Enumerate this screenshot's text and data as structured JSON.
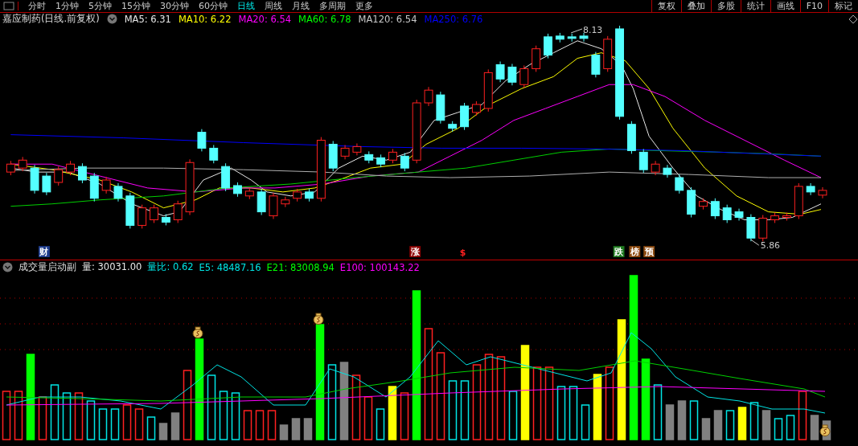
{
  "top_tabs": [
    {
      "label": "分时",
      "selected": false
    },
    {
      "label": "1分钟",
      "selected": false
    },
    {
      "label": "5分钟",
      "selected": false
    },
    {
      "label": "15分钟",
      "selected": false
    },
    {
      "label": "30分钟",
      "selected": false
    },
    {
      "label": "60分钟",
      "selected": false
    },
    {
      "label": "日线",
      "selected": true
    },
    {
      "label": "周线",
      "selected": false
    },
    {
      "label": "月线",
      "selected": false
    },
    {
      "label": "多周期",
      "selected": false
    },
    {
      "label": "更多",
      "selected": false
    }
  ],
  "toolbar_buttons": [
    "复权",
    "叠加",
    "多股",
    "统计",
    "画线",
    "F10",
    "标记"
  ],
  "price_panel": {
    "title": "嘉应制药(日线.前复权)",
    "indicators": [
      {
        "label": "MA5: 6.31",
        "color": "#e8e8e8"
      },
      {
        "label": "MA10: 6.22",
        "color": "#ffff00"
      },
      {
        "label": "MA20: 6.54",
        "color": "#ff00ff"
      },
      {
        "label": "MA60: 6.78",
        "color": "#00ff00"
      },
      {
        "label": "MA120: 6.54",
        "color": "#c8c8c8"
      },
      {
        "label": "MA250: 6.76",
        "color": "#0000ff"
      }
    ],
    "high_label": "8.13",
    "low_label": "5.86",
    "markers": [
      {
        "text": "财",
        "kind": "box",
        "color": "#1e3c8c"
      },
      {
        "text": "涨",
        "kind": "box",
        "color": "#8c0000"
      },
      {
        "text": "$",
        "kind": "glyph",
        "color": "#ff2020"
      },
      {
        "text": "跌",
        "kind": "box",
        "color": "#1e7a1e"
      },
      {
        "text": "榜",
        "kind": "box",
        "color": "#8c4a10"
      },
      {
        "text": "预",
        "kind": "box",
        "color": "#8c4a10"
      }
    ]
  },
  "volume_panel": {
    "title": "成交量启动副",
    "indicators": [
      {
        "label": "量: 30031.00",
        "color": "#e8e8e8"
      },
      {
        "label": "量比: 0.62",
        "color": "#00e5e5"
      },
      {
        "label": "E5: 48487.16",
        "color": "#00e5e5"
      },
      {
        "label": "E21: 83008.94",
        "color": "#00ff00"
      },
      {
        "label": "E100: 100143.22",
        "color": "#ff00ff"
      }
    ]
  }
}
